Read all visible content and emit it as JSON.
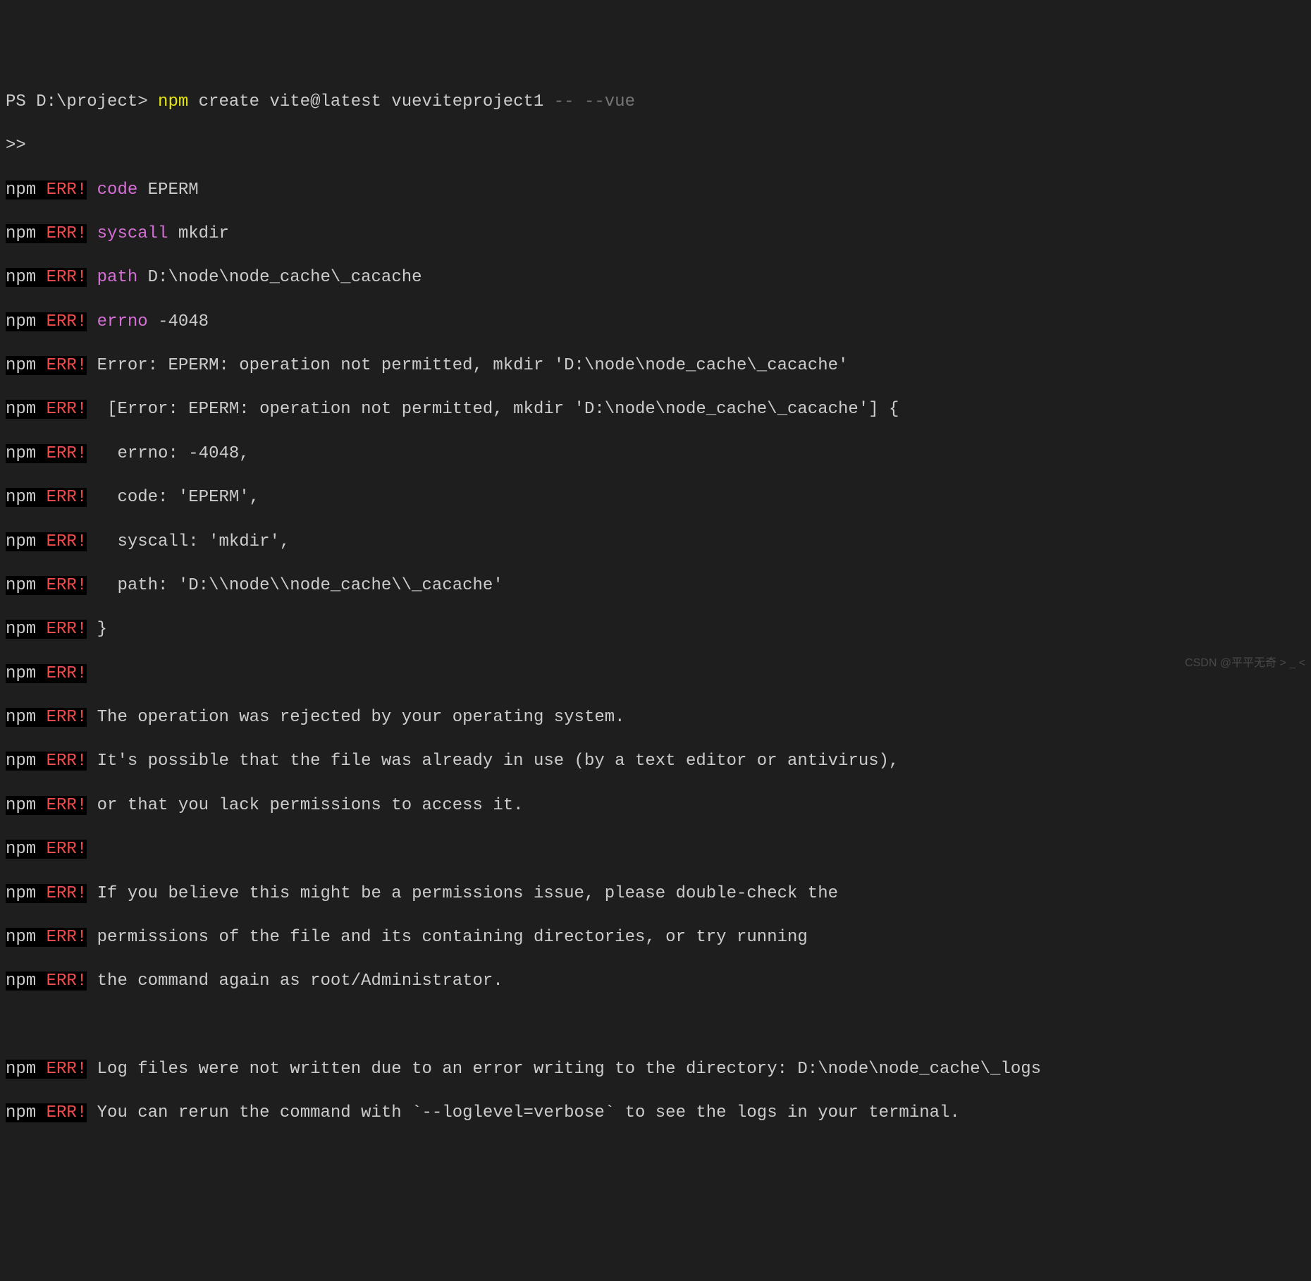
{
  "prompt": {
    "ps": "PS ",
    "path": "D:\\project> ",
    "cmd_yellow": "npm ",
    "cmd_rest": "create vite@latest vueviteproject1 ",
    "cmd_gray": "-- --vue"
  },
  "continuation": ">>",
  "npm": "npm",
  "err": " ERR!",
  "lines": {
    "l1_key": "code ",
    "l1_val": "EPERM",
    "l2_key": "syscall ",
    "l2_val": "mkdir",
    "l3_key": "path ",
    "l3_val": "D:\\node\\node_cache\\_cacache",
    "l4_key": "errno ",
    "l4_val": "-4048",
    "l5": "Error: EPERM: operation not permitted, mkdir 'D:\\node\\node_cache\\_cacache'",
    "l6": " [Error: EPERM: operation not permitted, mkdir 'D:\\node\\node_cache\\_cacache'] {",
    "l7": "  errno: -4048,",
    "l8": "  code: 'EPERM',",
    "l9": "  syscall: 'mkdir',",
    "l10": "  path: 'D:\\\\node\\\\node_cache\\\\_cacache'",
    "l11": "}",
    "l12": "",
    "l13": "The operation was rejected by your operating system.",
    "l14": "It's possible that the file was already in use (by a text editor or antivirus),",
    "l15": "or that you lack permissions to access it.",
    "l16": "",
    "l17": "If you believe this might be a permissions issue, please double-check the",
    "l18": "permissions of the file and its containing directories, or try running",
    "l19": "the command again as root/Administrator.",
    "l20": "Log files were not written due to an error writing to the directory: D:\\node\\node_cache\\_logs",
    "l21": "You can rerun the command with `--loglevel=verbose` to see the logs in your terminal."
  },
  "watermark": "CSDN @平平无奇 > _ <"
}
